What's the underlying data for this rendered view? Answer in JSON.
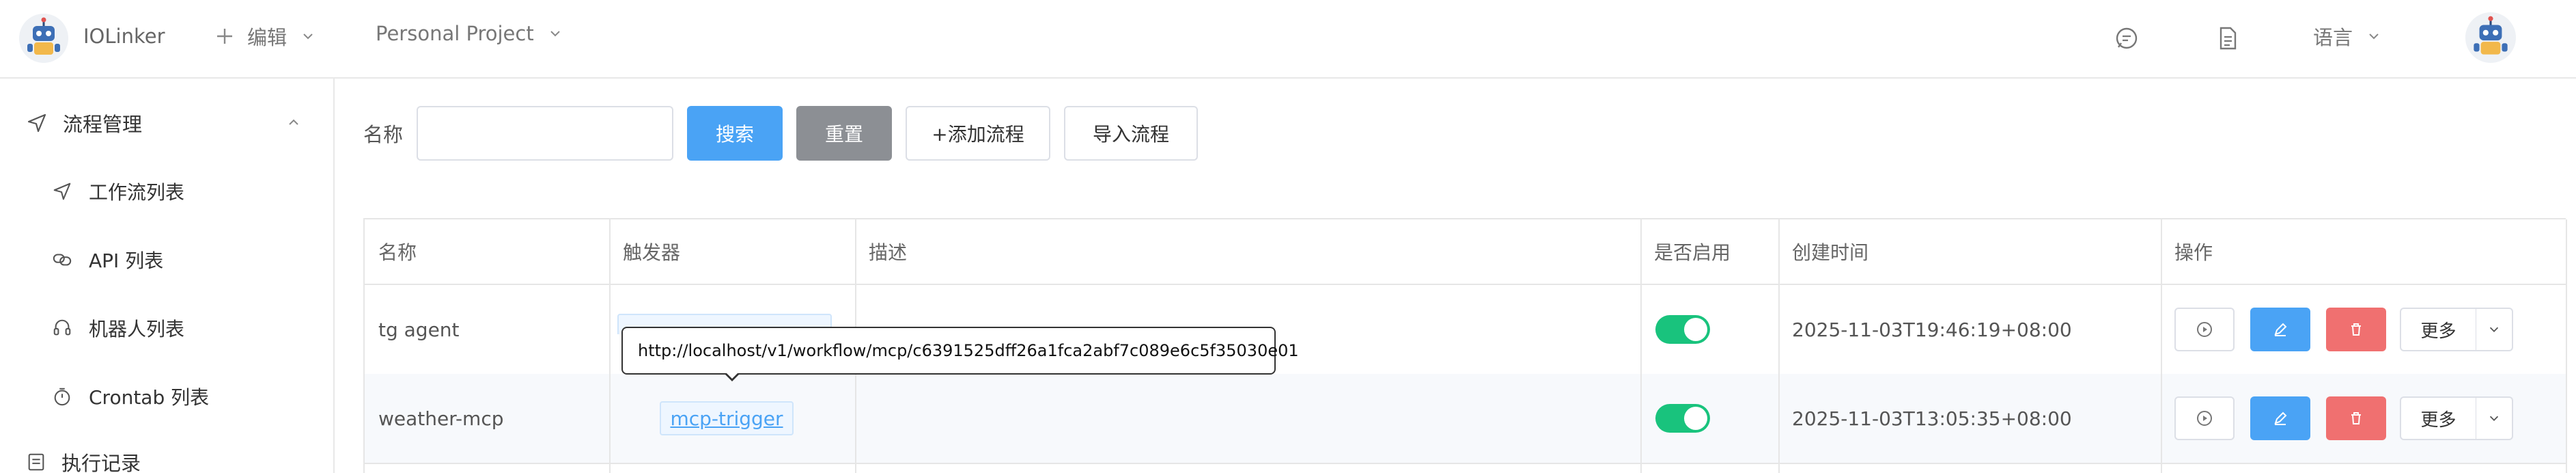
{
  "header": {
    "app_name": "IOLinker",
    "edit_label": "编辑",
    "project_label": "Personal Project",
    "language_label": "语言",
    "icons": [
      "robot-logo-icon",
      "plus-icon",
      "chevron-down-icon",
      "chat-icon",
      "document-icon",
      "user-avatar-robot-icon"
    ]
  },
  "sidebar": {
    "group_label": "流程管理",
    "items": [
      {
        "label": "工作流列表",
        "icon": "send-icon"
      },
      {
        "label": "API 列表",
        "icon": "link-icon"
      },
      {
        "label": "机器人列表",
        "icon": "headset-icon"
      },
      {
        "label": "Crontab 列表",
        "icon": "timer-icon"
      }
    ],
    "exec_label": "执行记录"
  },
  "search": {
    "label": "名称",
    "value": "",
    "placeholder": "",
    "search_button": "搜索",
    "reset_button": "重置",
    "add_button": "+添加流程",
    "import_button": "导入流程"
  },
  "table": {
    "columns": [
      "名称",
      "触发器",
      "描述",
      "是否启用",
      "创建时间",
      "操作"
    ],
    "rows": [
      {
        "name": "tg agent",
        "trigger": "",
        "description": "",
        "enabled": true,
        "created_at": "2025-11-03T19:46:19+08:00",
        "more_label": "更多"
      },
      {
        "name": "weather-mcp",
        "trigger": "mcp-trigger",
        "description": "",
        "enabled": true,
        "created_at": "2025-11-03T13:05:35+08:00",
        "more_label": "更多"
      }
    ]
  },
  "tooltip": {
    "text": "http://localhost/v1/workflow/mcp/c6391525dff26a1fca2abf7c089e6c5f35030e01"
  },
  "colors": {
    "primary": "#4aa3f5",
    "reset_gray": "#8c8f94",
    "danger": "#f07070",
    "switch_on": "#19c37d",
    "border": "#e6e6e6"
  }
}
